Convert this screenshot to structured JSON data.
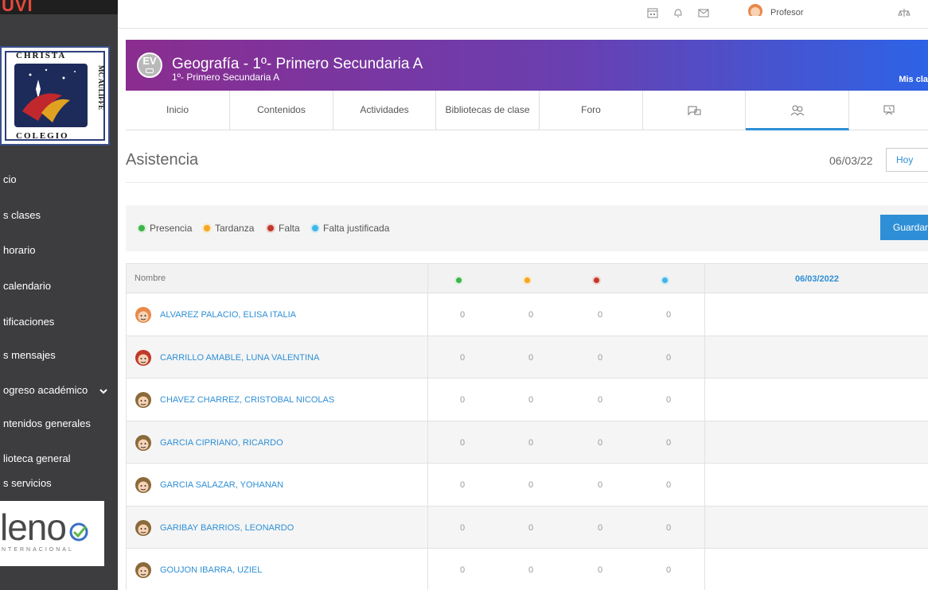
{
  "sidebar": {
    "top_logo_text": "UVI",
    "school_logo": {
      "top_text": "CHRISTA",
      "side_text": "MC AULIFFE",
      "bottom_text": "COLEGIO"
    },
    "items": [
      {
        "label": "cio"
      },
      {
        "label": "s clases"
      },
      {
        "label": "horario"
      },
      {
        "label": "calendario"
      },
      {
        "label": "tificaciones"
      },
      {
        "label": "s mensajes"
      },
      {
        "label": "ogreso académico"
      },
      {
        "label": "ntenidos generales"
      },
      {
        "label": "lioteca general"
      },
      {
        "label": "s servicios"
      }
    ],
    "partner_logo": {
      "text": "leno",
      "subtext": "NTERNACIONAL"
    }
  },
  "topbar": {
    "profile_label": "Profesor",
    "icons": [
      "calendar-icon",
      "bell-icon",
      "mail-icon",
      "balance-icon"
    ]
  },
  "class_header": {
    "avatar_text": "EV",
    "title": "Geografía  - 1º- Primero Secundaria A",
    "subtitle": "1º- Primero Secundaria A",
    "my_classes": "Mis cla"
  },
  "tabs": [
    {
      "label": "Inicio"
    },
    {
      "label": "Contenidos"
    },
    {
      "label": "Actividades"
    },
    {
      "label": "Bibliotecas de clase"
    },
    {
      "label": "Foro"
    }
  ],
  "attendance": {
    "title": "Asistencia",
    "date": "06/03/22",
    "today_button": "Hoy",
    "save_button": "Guardar",
    "legend": [
      {
        "label": "Presencia",
        "color": "#3cb44b"
      },
      {
        "label": "Tardanza",
        "color": "#f5a623"
      },
      {
        "label": "Falta",
        "color": "#c0392b"
      },
      {
        "label": "Falta justificada",
        "color": "#3fb6e6"
      }
    ],
    "table": {
      "name_header": "Nombre",
      "date_header": "06/03/2022",
      "rows": [
        {
          "name": "ALVAREZ PALACIO, ELISA ITALIA",
          "counts": [
            "0",
            "0",
            "0",
            "0"
          ]
        },
        {
          "name": "CARRILLO AMABLE, LUNA VALENTINA",
          "counts": [
            "0",
            "0",
            "0",
            "0"
          ]
        },
        {
          "name": "CHAVEZ CHARREZ, CRISTOBAL NICOLAS",
          "counts": [
            "0",
            "0",
            "0",
            "0"
          ]
        },
        {
          "name": "GARCIA CIPRIANO, RICARDO",
          "counts": [
            "0",
            "0",
            "0",
            "0"
          ]
        },
        {
          "name": "GARCIA SALAZAR, YOHANAN",
          "counts": [
            "0",
            "0",
            "0",
            "0"
          ]
        },
        {
          "name": "GARIBAY BARRIOS, LEONARDO",
          "counts": [
            "0",
            "0",
            "0",
            "0"
          ]
        },
        {
          "name": "GOUJON IBARRA, UZIEL",
          "counts": [
            "0",
            "0",
            "0",
            "0"
          ]
        }
      ]
    }
  }
}
